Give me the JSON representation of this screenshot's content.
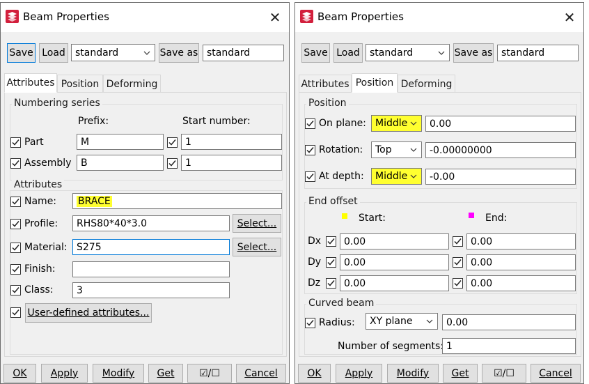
{
  "colors": {
    "highlight": "#ffff30",
    "start_marker": "#ffff00",
    "end_marker": "#ff00ff",
    "focus": "#0078d7"
  },
  "left": {
    "title": "Beam Properties",
    "close_glyph": "✕",
    "toolbar": {
      "save": "Save",
      "load": "Load",
      "preset": "standard",
      "save_as": "Save as",
      "save_as_name": "standard"
    },
    "tabs": [
      "Attributes",
      "Position",
      "Deforming"
    ],
    "numbering": {
      "title": "Numbering series",
      "prefix_header": "Prefix:",
      "start_header": "Start number:",
      "rows": [
        {
          "label": "Part",
          "prefix": "M",
          "start": "1"
        },
        {
          "label": "Assembly",
          "prefix": "B",
          "start": "1"
        }
      ]
    },
    "attributes": {
      "title": "Attributes",
      "name_label": "Name:",
      "name_value": "BRACE",
      "profile_label": "Profile:",
      "profile_value": "RHS80*40*3.0",
      "profile_select": "Select...",
      "material_label": "Material:",
      "material_value": "S275",
      "material_select": "Select...",
      "finish_label": "Finish:",
      "finish_value": "",
      "class_label": "Class:",
      "class_value": "3",
      "uda_button": "User-defined attributes..."
    },
    "bottom": {
      "ok": "OK",
      "apply": "Apply",
      "modify": "Modify",
      "get": "Get",
      "toggle": "☑/☐",
      "cancel": "Cancel"
    }
  },
  "right": {
    "title": "Beam Properties",
    "close_glyph": "✕",
    "toolbar": {
      "save": "Save",
      "load": "Load",
      "preset": "standard",
      "save_as": "Save as",
      "save_as_name": "standard"
    },
    "tabs": [
      "Attributes",
      "Position",
      "Deforming"
    ],
    "position": {
      "title": "Position",
      "on_plane_label": "On plane:",
      "on_plane_select": "Middle",
      "on_plane_value": "0.00",
      "rotation_label": "Rotation:",
      "rotation_select": "Top",
      "rotation_value": "-0.00000000",
      "depth_label": "At depth:",
      "depth_select": "Middle",
      "depth_value": "-0.00"
    },
    "end_offset": {
      "title": "End offset",
      "start_header": "Start:",
      "end_header": "End:",
      "rows": [
        {
          "label": "Dx",
          "start": "0.00",
          "end": "0.00"
        },
        {
          "label": "Dy",
          "start": "0.00",
          "end": "0.00"
        },
        {
          "label": "Dz",
          "start": "0.00",
          "end": "0.00"
        }
      ]
    },
    "curved": {
      "title": "Curved beam",
      "radius_label": "Radius:",
      "radius_select": "XY plane",
      "radius_value": "0.00",
      "segments_label": "Number of segments:",
      "segments_value": "1"
    },
    "bottom": {
      "ok": "OK",
      "apply": "Apply",
      "modify": "Modify",
      "get": "Get",
      "toggle": "☑/☐",
      "cancel": "Cancel"
    }
  }
}
